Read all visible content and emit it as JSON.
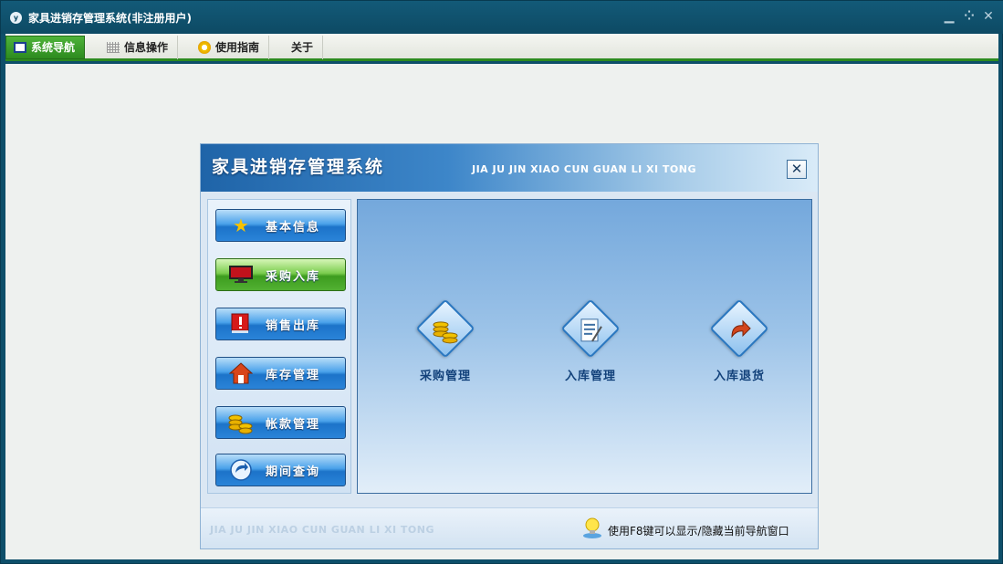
{
  "window": {
    "title": "家具进销存管理系统(非注册用户)",
    "controls": {
      "minimize": "▁",
      "restore": "⁘",
      "close": "✕"
    }
  },
  "toolbar": {
    "tabs": [
      {
        "label": "系统导航",
        "icon": "monitor-icon",
        "active": true
      },
      {
        "label": "信息操作",
        "icon": "grid-icon",
        "active": false
      },
      {
        "label": "使用指南",
        "icon": "clock-icon",
        "active": false
      },
      {
        "label": "关于",
        "icon": "",
        "active": false
      }
    ]
  },
  "panel": {
    "title": "家具进销存管理系统",
    "subtitle": "JIA JU JIN XIAO CUN  GUAN LI XI TONG",
    "close_label": "✕",
    "nav": [
      {
        "label": "基本信息",
        "icon": "star-icon",
        "glyph": "★",
        "color": "#f7c200",
        "active": false
      },
      {
        "label": "采购入库",
        "icon": "monitor-icon",
        "glyph": "▬",
        "color": "#c1121c",
        "active": true
      },
      {
        "label": "销售出库",
        "icon": "alert-icon",
        "glyph": "!",
        "color": "#d61a1a",
        "active": false
      },
      {
        "label": "库存管理",
        "icon": "home-icon",
        "glyph": "⌂",
        "color": "#d8451b",
        "active": false
      },
      {
        "label": "帐款管理",
        "icon": "coins-icon",
        "glyph": "●",
        "color": "#e8b100",
        "active": false
      },
      {
        "label": "期间查询",
        "icon": "refresh-icon",
        "glyph": "↻",
        "color": "#1c5fae",
        "active": false
      }
    ],
    "actions": [
      {
        "label": "采购管理",
        "icon": "coins-icon",
        "glyph": "●",
        "color": "#e2a800"
      },
      {
        "label": "入库管理",
        "icon": "document-icon",
        "glyph": "▤",
        "color": "#3d6fa3"
      },
      {
        "label": "入库退货",
        "icon": "return-arrow-icon",
        "glyph": "↶",
        "color": "#d2451d"
      }
    ],
    "footer_subtitle": "JIA JU JIN XIAO CUN GUAN LI XI TONG",
    "hint": "使用F8键可以显示/隐藏当前导航窗口"
  }
}
